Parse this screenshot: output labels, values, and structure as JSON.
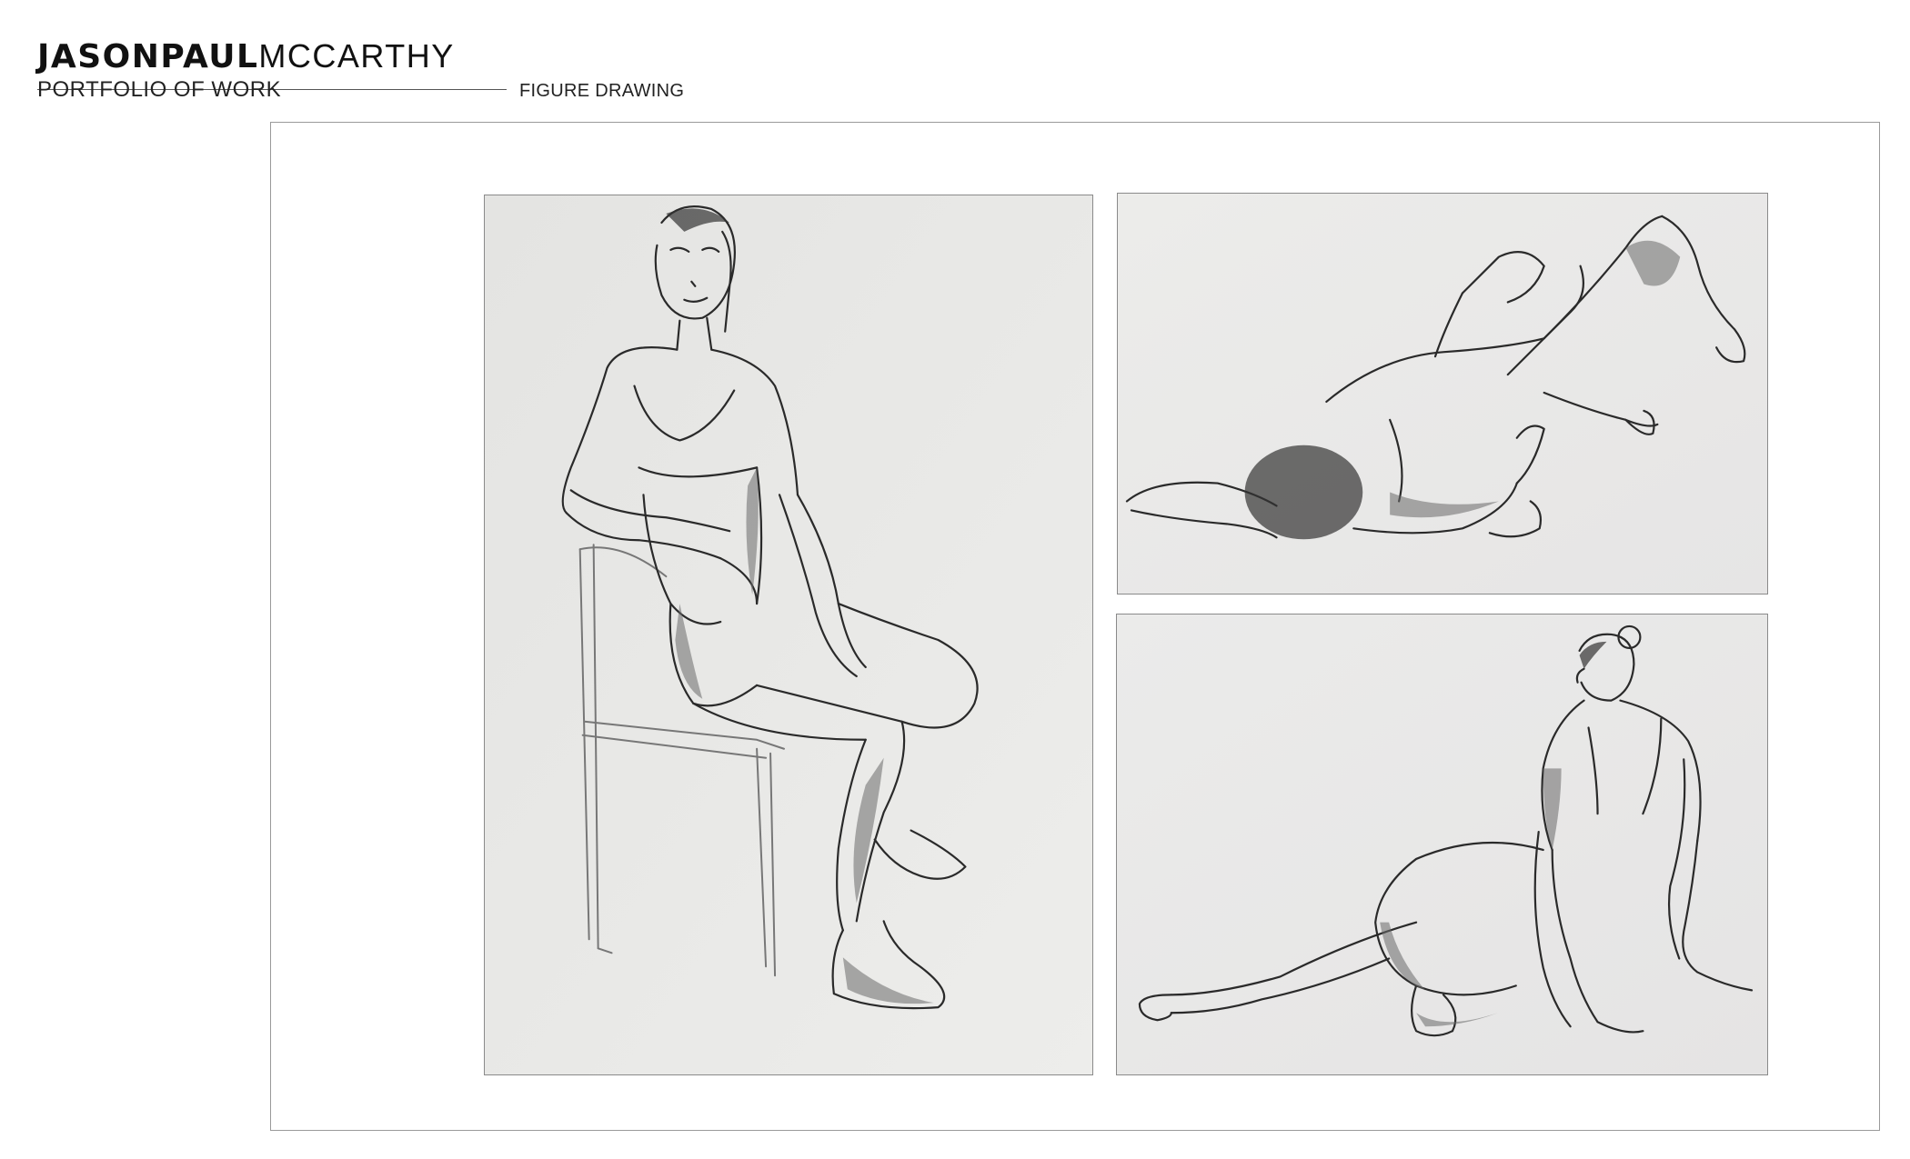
{
  "header": {
    "name_first": "JASONPAUL",
    "name_last": "MCCARTHY",
    "subtitle": "PORTFOLIO OF WORK",
    "section": "FIGURE DRAWING"
  },
  "drawings": [
    {
      "subject": "seated figure on a chair"
    },
    {
      "subject": "reclining figure on the floor"
    },
    {
      "subject": "figure seated on the floor, leaning back"
    }
  ],
  "colors": {
    "paper": "#e8e8e6",
    "frame_border": "#9a9a9a",
    "text": "#111111"
  }
}
